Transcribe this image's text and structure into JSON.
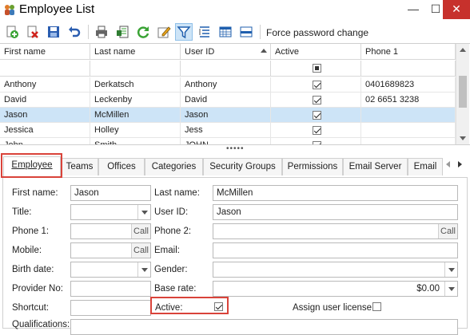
{
  "window": {
    "title": "Employee List",
    "minimize_glyph": "—",
    "maximize_glyph": "☐",
    "close_glyph": "✕"
  },
  "toolbar": {
    "buttons": [
      {
        "icon": "add-icon"
      },
      {
        "icon": "delete-icon"
      },
      {
        "icon": "save-icon"
      },
      {
        "icon": "undo-icon"
      },
      {
        "icon": "print-icon"
      },
      {
        "icon": "export-icon"
      },
      {
        "icon": "refresh-icon"
      },
      {
        "icon": "edit-icon"
      },
      {
        "icon": "filter-icon"
      },
      {
        "icon": "group-icon"
      },
      {
        "icon": "columns-icon"
      },
      {
        "icon": "panel-icon"
      }
    ],
    "force_password_label": "Force password change"
  },
  "grid": {
    "columns": [
      "First name",
      "Last name",
      "User ID",
      "Active",
      "Phone 1"
    ],
    "rows": [
      {
        "first": "Anthony",
        "last": "Derkatsch",
        "userid": "Anthony",
        "active": true,
        "phone": "0401689823",
        "selected": false
      },
      {
        "first": "David",
        "last": "Leckenby",
        "userid": "David",
        "active": true,
        "phone": "02 6651 3238",
        "selected": false
      },
      {
        "first": "Jason",
        "last": "McMillen",
        "userid": "Jason",
        "active": true,
        "phone": "",
        "selected": true
      },
      {
        "first": "Jessica",
        "last": "Holley",
        "userid": "Jess",
        "active": true,
        "phone": "",
        "selected": false
      },
      {
        "first": "John",
        "last": "Smith",
        "userid": "JOHN",
        "active": true,
        "phone": "",
        "selected": false
      }
    ]
  },
  "tabs": [
    "Employee",
    "Teams",
    "Offices",
    "Categories",
    "Security Groups",
    "Permissions",
    "Email Server",
    "Email"
  ],
  "form": {
    "first_name_label": "First name:",
    "first_name_value": "Jason",
    "last_name_label": "Last name:",
    "last_name_value": "McMillen",
    "title_label": "Title:",
    "title_value": "",
    "user_id_label": "User ID:",
    "user_id_value": "Jason",
    "phone1_label": "Phone 1:",
    "phone1_value": "",
    "phone2_label": "Phone 2:",
    "phone2_value": "",
    "mobile_label": "Mobile:",
    "mobile_value": "",
    "email_label": "Email:",
    "email_value": "",
    "birth_date_label": "Birth date:",
    "birth_date_value": "",
    "gender_label": "Gender:",
    "gender_value": "",
    "provider_no_label": "Provider No:",
    "provider_no_value": "",
    "base_rate_label": "Base rate:",
    "base_rate_value": "$0.00",
    "shortcut_label": "Shortcut:",
    "shortcut_value": "",
    "active_label": "Active:",
    "active_checked": true,
    "assign_license_label": "Assign user license:",
    "assign_license_checked": false,
    "qualifications_label": "Qualifications:",
    "call_label": "Call"
  },
  "colors": {
    "selection": "#cde4f7",
    "highlight_box": "#d9433a",
    "close_button": "#c7312c"
  }
}
